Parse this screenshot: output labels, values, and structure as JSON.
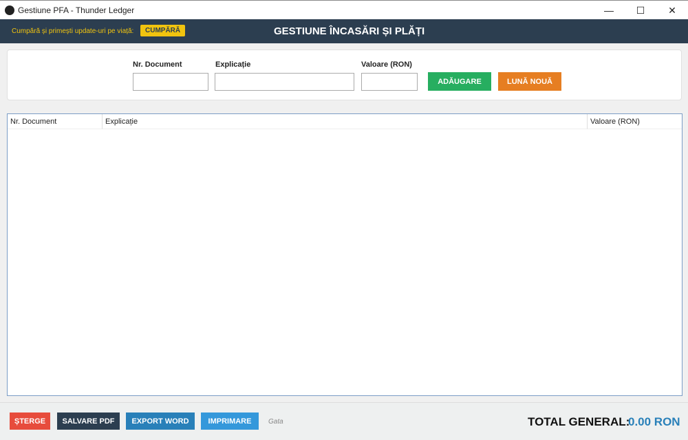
{
  "window": {
    "title": "Gestiune PFA - Thunder Ledger",
    "minimize": "—",
    "maximize": "☐",
    "close": "✕"
  },
  "banner": {
    "promo": "Cumpără și primești update-uri pe viață:",
    "buy": "CUMPĂRĂ",
    "heading": "GESTIUNE ÎNCASĂRI ȘI PLĂȚI"
  },
  "form": {
    "doc_label": "Nr. Document",
    "doc_value": "",
    "expl_label": "Explicație",
    "expl_value": "",
    "val_label": "Valoare (RON)",
    "val_value": "",
    "add": "ADĂUGARE",
    "new_month": "LUNĂ NOUĂ"
  },
  "table": {
    "columns": [
      "Nr. Document",
      "Explicație",
      "Valoare (RON)"
    ],
    "rows": []
  },
  "footer": {
    "delete": "ȘTERGE",
    "pdf": "SALVARE PDF",
    "word": "EXPORT WORD",
    "print": "IMPRIMARE",
    "status": "Gata",
    "total_label": "TOTAL GENERAL:",
    "total_value": "0.00 RON"
  },
  "colors": {
    "add": "#27ae60",
    "new_month": "#e67e22",
    "delete": "#e74c3c",
    "pdf": "#2c3e50",
    "word": "#2980b9",
    "print": "#3498db"
  }
}
